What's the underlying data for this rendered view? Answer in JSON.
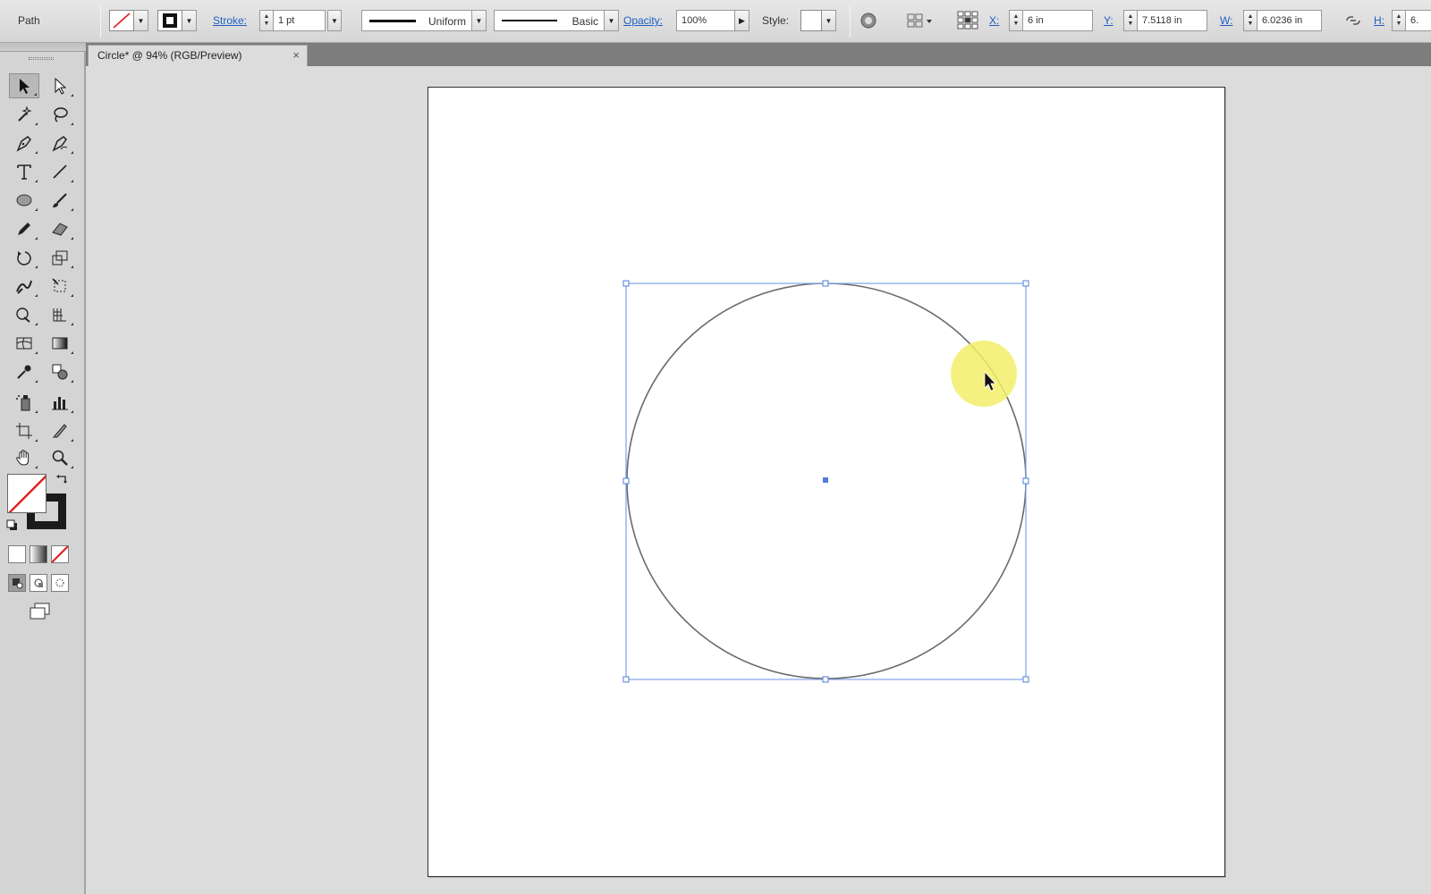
{
  "control_bar": {
    "selection_type": "Path",
    "stroke_label": "Stroke:",
    "stroke_weight": "1 pt",
    "variable_width_profile": "Uniform",
    "brush_definition": "Basic",
    "opacity_label": "Opacity:",
    "opacity_value": "100%",
    "style_label": "Style:",
    "x_label": "X:",
    "x_value": "6 in",
    "y_label": "Y:",
    "y_value": "7.5118 in",
    "w_label": "W:",
    "w_value": "6.0236 in",
    "h_label": "H:",
    "h_value": "6."
  },
  "document_tab": {
    "title": "Circle* @ 94% (RGB/Preview)",
    "close_glyph": "×"
  },
  "tools": [
    "selection-tool",
    "direct-selection-tool",
    "magic-wand-tool",
    "lasso-tool",
    "pen-tool",
    "curvature-tool",
    "type-tool",
    "line-segment-tool",
    "ellipse-tool",
    "paintbrush-tool",
    "pencil-tool",
    "eraser-tool",
    "rotate-tool",
    "scale-tool",
    "warp-tool",
    "free-transform-tool",
    "shape-builder-tool",
    "perspective-grid-tool",
    "mesh-tool",
    "gradient-tool",
    "eyedropper-tool",
    "blend-tool",
    "symbol-sprayer-tool",
    "column-graph-tool",
    "artboard-tool",
    "slice-tool",
    "hand-tool",
    "zoom-tool"
  ],
  "colors": {
    "selection_blue": "#7fa4e6",
    "anchor_blue": "#4f7fd6",
    "path_stroke": "#6b6b6b",
    "cursor_highlight": "#f2ef6a",
    "none_red": "#e02020"
  },
  "icons": {
    "fill_swatch": "none-fill-icon",
    "stroke_swatch": "black-stroke-icon",
    "cursor": "arrow-cursor-icon"
  }
}
